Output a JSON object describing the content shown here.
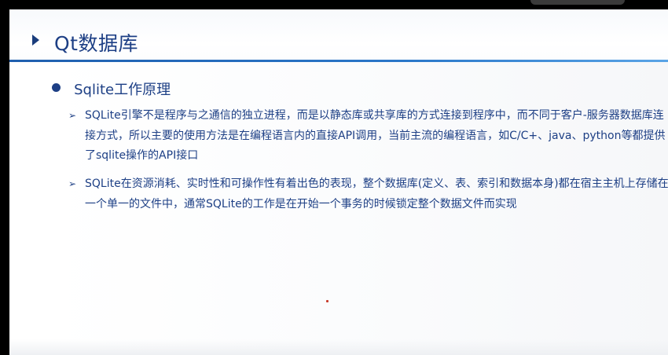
{
  "slide": {
    "title": "Qt数据库",
    "bullet_heading": "Sqlite工作原理",
    "sub_marker": "➢",
    "items": [
      {
        "text": "SQLite引擎不是程序与之通信的独立进程，而是以静态库或共享库的方式连接到程序中，而不同于客户-服务器数据库连接方式，所以主要的使用方法是在编程语言内的直接API调用，当前主流的编程语言，如C/C+、java、python等都提供了sqlite操作的API接口"
      },
      {
        "text": "SQLite在资源消耗、实时性和可操作性有着出色的表现，整个数据库(定义、表、索引和数据本身)都在宿主主机上存储在一个单一的文件中，通常SQLite的工作是在开始一个事务的时候锁定整个数据文件而实现"
      }
    ]
  },
  "colors": {
    "title_text": "#1d3f85",
    "accent_rule": "#1f5fae",
    "body_text": "#1d3f85",
    "frame": "#000000"
  }
}
